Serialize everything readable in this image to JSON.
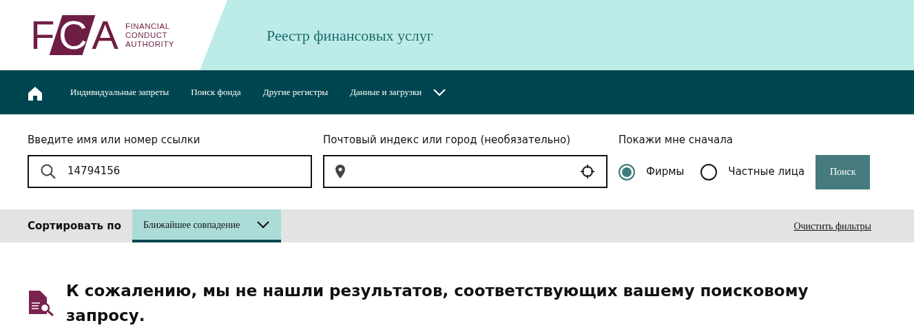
{
  "header": {
    "logo": {
      "mark": "FCA",
      "lines": [
        "FINANCIAL",
        "CONDUCT",
        "AUTHORITY"
      ]
    },
    "title": "Реестр финансовых услуг"
  },
  "nav": {
    "items": [
      {
        "label": "Индивидуальные запреты",
        "kind": "link"
      },
      {
        "label": "Поиск фонда",
        "kind": "link"
      },
      {
        "label": "Другие регистры",
        "kind": "link"
      },
      {
        "label": "Данные и загрузки",
        "kind": "dropdown"
      }
    ]
  },
  "search": {
    "name_label": "Введите имя или номер ссылки",
    "name_value": "14794156",
    "postcode_label": "Почтовый индекс или город (необязательно)",
    "show_label": "Покажи мне сначала",
    "options": [
      {
        "label": "Фирмы",
        "selected": true
      },
      {
        "label": "Частные лица",
        "selected": false
      }
    ],
    "button": "Поиск"
  },
  "sort": {
    "label": "Сортировать по",
    "value": "Ближайшее совпадение",
    "clear": "Очистить фильтры"
  },
  "message": "К сожалению, мы не нашли результатов, соответствующих вашему поисковому запросу."
}
